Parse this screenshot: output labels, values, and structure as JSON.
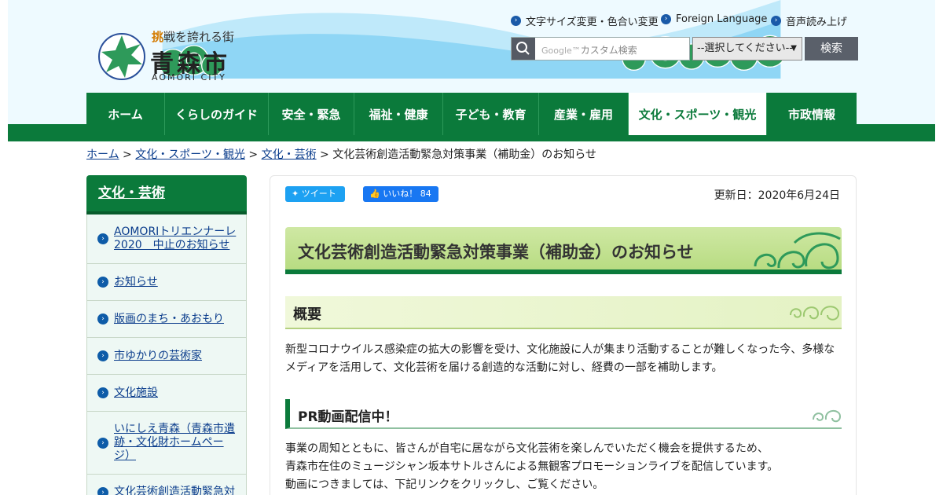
{
  "header": {
    "logo_tagline_lead": "挑",
    "logo_tagline_rest": "戦を誇れる街",
    "logo_name": "青森市",
    "logo_en": "AOMORI CITY",
    "util_links": [
      {
        "label": "文字サイズ変更・色合い変更"
      },
      {
        "label": "Foreign Language"
      },
      {
        "label": "音声読み上げ"
      }
    ],
    "search_placeholder": "カスタム検索",
    "search_google": "Google™",
    "select_value": "--選択してください--",
    "search_button": "検索"
  },
  "nav": {
    "items": [
      {
        "label": "ホーム"
      },
      {
        "label": "くらしのガイド"
      },
      {
        "label": "安全・緊急"
      },
      {
        "label": "福祉・健康"
      },
      {
        "label": "子ども・教育"
      },
      {
        "label": "産業・雇用"
      },
      {
        "label": "文化・スポーツ・観光"
      },
      {
        "label": "市政情報"
      }
    ]
  },
  "breadcrumb": {
    "home": "ホーム",
    "cat": "文化・スポーツ・観光",
    "sub": "文化・芸術",
    "sep": " > ",
    "current": "文化芸術創造活動緊急対策事業（補助金）のお知らせ"
  },
  "sidebar": {
    "title": "文化・芸術",
    "items": [
      {
        "label": "AOMORIトリエンナーレ2020　中止のお知らせ"
      },
      {
        "label": "お知らせ"
      },
      {
        "label": "版画のまち・あおもり"
      },
      {
        "label": "市ゆかりの芸術家"
      },
      {
        "label": "文化施設"
      },
      {
        "label": "いにしえ青森（青森市遺跡・文化財ホームページ）"
      },
      {
        "label": "文化芸術創造活動緊急対"
      }
    ]
  },
  "content": {
    "tweet": "ツイート",
    "like": "いいね！",
    "like_count": "84",
    "updated": "更新日：2020年6月24日",
    "title": "文化芸術創造活動緊急対策事業（補助金）のお知らせ",
    "overview_heading": "概要",
    "overview_text": "新型コロナウイルス感染症の拡大の影響を受け、文化施設に人が集まり活動することが難しくなった今、多様なメディアを活用して、文化芸術を届ける創造的な活動に対し、経費の一部を補助します。",
    "pr_heading": "PR動画配信中！",
    "pr_lines": [
      "事業の周知とともに、皆さんが自宅に居ながら文化芸術を楽しんでいただく機会を提供するため、",
      "青森市在住のミュージシャン坂本サトルさんによる無観客プロモーションライブを配信しています。",
      "動画につきましては、下記リンクをクリックし、ご覧ください。"
    ]
  },
  "colors": {
    "nav_green": "#0b7a3b",
    "link_blue": "#0b3d8c",
    "header_sky": "#8fd6f5"
  }
}
